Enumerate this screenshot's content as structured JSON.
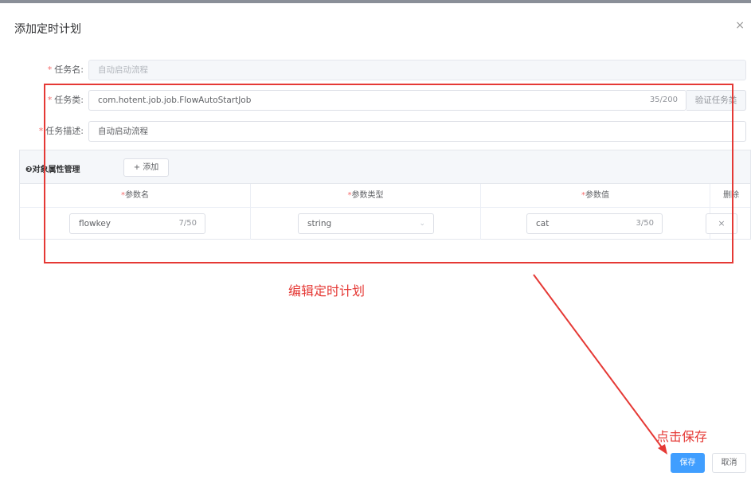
{
  "dialog": {
    "title": "添加定时计划",
    "close_glyph": "×"
  },
  "form": {
    "required_mark": "*",
    "task_name": {
      "label": "任务名:",
      "placeholder": "自动启动流程"
    },
    "task_class": {
      "label": "任务类:",
      "value": "com.hotent.job.job.FlowAutoStartJob",
      "counter": "35/200",
      "append_label": "验证任务类"
    },
    "task_desc": {
      "label": "任务描述:",
      "value": "自动启动流程"
    }
  },
  "params_panel": {
    "title": "❷对象属性管理",
    "add_button": "+ 添加",
    "columns": [
      {
        "label": "参数名",
        "required": "*"
      },
      {
        "label": "参数类型",
        "required": "*"
      },
      {
        "label": "参数值",
        "required": "*"
      },
      {
        "label": "删除",
        "required": ""
      }
    ],
    "rows": [
      {
        "name": "flowkey",
        "name_counter": "7/50",
        "type": "string",
        "value": "cat",
        "value_counter": "3/50",
        "delete_glyph": "×"
      }
    ],
    "select_chevron": "⌄"
  },
  "annotations": {
    "edit_note": "编辑定时计划",
    "save_note": "点击保存",
    "color": "#e53935"
  },
  "footer": {
    "save_label": "保存",
    "cancel_label": "取消"
  },
  "colors": {
    "primary": "#409eff",
    "required": "#f56c6c"
  },
  "icons": {
    "close": "close-icon",
    "plus": "plus-icon",
    "chevron": "chevron-down-icon",
    "delete": "close-icon"
  }
}
